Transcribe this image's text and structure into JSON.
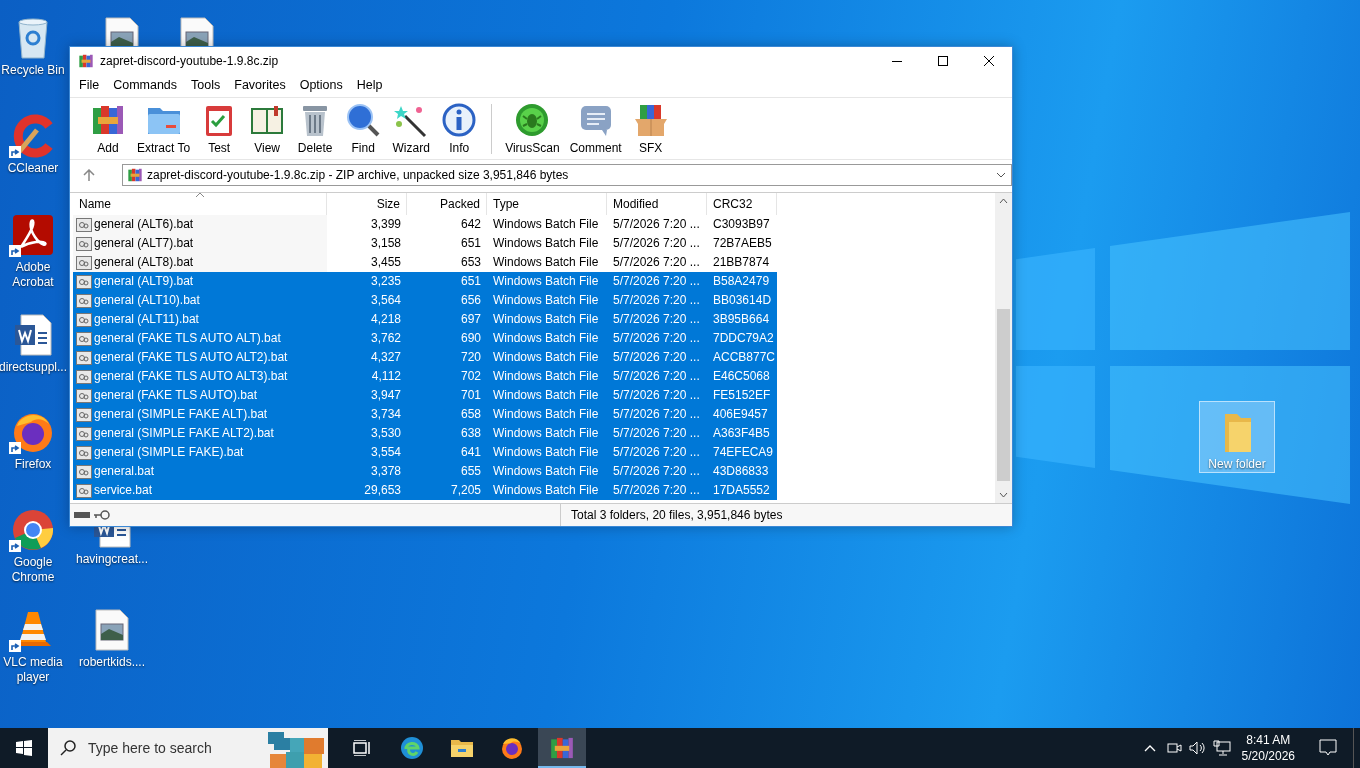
{
  "desktop": {
    "icons": [
      {
        "label": "Recycle Bin",
        "shortcut": false,
        "selected": false
      },
      {
        "label": "CCleaner",
        "shortcut": true,
        "selected": false
      },
      {
        "label": "Adobe Acrobat",
        "shortcut": true,
        "selected": false
      },
      {
        "label": "directsuppl...",
        "shortcut": false,
        "selected": false
      },
      {
        "label": "Firefox",
        "shortcut": true,
        "selected": false
      },
      {
        "label": "Google Chrome",
        "shortcut": true,
        "selected": false
      },
      {
        "label": "VLC media player",
        "shortcut": true,
        "selected": false
      },
      {
        "label": "havingcreat...",
        "shortcut": false,
        "selected": false
      },
      {
        "label": "robertkids....",
        "shortcut": false,
        "selected": false
      },
      {
        "label": "New folder",
        "shortcut": false,
        "selected": true
      }
    ]
  },
  "window": {
    "title": "zapret-discord-youtube-1.9.8c.zip",
    "menu": [
      "File",
      "Commands",
      "Tools",
      "Favorites",
      "Options",
      "Help"
    ],
    "toolbar": [
      [
        {
          "label": "Add"
        },
        {
          "label": "Extract To"
        },
        {
          "label": "Test"
        },
        {
          "label": "View"
        },
        {
          "label": "Delete"
        },
        {
          "label": "Find"
        },
        {
          "label": "Wizard"
        },
        {
          "label": "Info"
        }
      ],
      [
        {
          "label": "VirusScan"
        },
        {
          "label": "Comment"
        },
        {
          "label": "SFX"
        }
      ]
    ],
    "address": "zapret-discord-youtube-1.9.8c.zip - ZIP archive, unpacked size 3,951,846 bytes",
    "table": {
      "columns": [
        {
          "label": "Name",
          "sorted": true
        },
        {
          "label": "Size",
          "sorted": false
        },
        {
          "label": "Packed",
          "sorted": false
        },
        {
          "label": "Type",
          "sorted": false
        },
        {
          "label": "Modified",
          "sorted": false
        },
        {
          "label": "CRC32",
          "sorted": false
        }
      ],
      "rows": [
        {
          "cells": [
            "general (ALT6).bat",
            "3,399",
            "642",
            "Windows Batch File",
            "5/7/2026 7:20 ...",
            "C3093B97"
          ],
          "selected": false
        },
        {
          "cells": [
            "general (ALT7).bat",
            "3,158",
            "651",
            "Windows Batch File",
            "5/7/2026 7:20 ...",
            "72B7AEB5"
          ],
          "selected": false
        },
        {
          "cells": [
            "general (ALT8).bat",
            "3,455",
            "653",
            "Windows Batch File",
            "5/7/2026 7:20 ...",
            "21BB7874"
          ],
          "selected": false
        },
        {
          "cells": [
            "general (ALT9).bat",
            "3,235",
            "651",
            "Windows Batch File",
            "5/7/2026 7:20 ...",
            "B58A2479"
          ],
          "selected": true
        },
        {
          "cells": [
            "general (ALT10).bat",
            "3,564",
            "656",
            "Windows Batch File",
            "5/7/2026 7:20 ...",
            "BB03614D"
          ],
          "selected": true
        },
        {
          "cells": [
            "general (ALT11).bat",
            "4,218",
            "697",
            "Windows Batch File",
            "5/7/2026 7:20 ...",
            "3B95B664"
          ],
          "selected": true
        },
        {
          "cells": [
            "general (FAKE TLS AUTO ALT).bat",
            "3,762",
            "690",
            "Windows Batch File",
            "5/7/2026 7:20 ...",
            "7DDC79A2"
          ],
          "selected": true
        },
        {
          "cells": [
            "general (FAKE TLS AUTO ALT2).bat",
            "4,327",
            "720",
            "Windows Batch File",
            "5/7/2026 7:20 ...",
            "ACCB877C"
          ],
          "selected": true
        },
        {
          "cells": [
            "general (FAKE TLS AUTO ALT3).bat",
            "4,112",
            "702",
            "Windows Batch File",
            "5/7/2026 7:20 ...",
            "E46C5068"
          ],
          "selected": true
        },
        {
          "cells": [
            "general (FAKE TLS AUTO).bat",
            "3,947",
            "701",
            "Windows Batch File",
            "5/7/2026 7:20 ...",
            "FE5152EF"
          ],
          "selected": true
        },
        {
          "cells": [
            "general (SIMPLE FAKE ALT).bat",
            "3,734",
            "658",
            "Windows Batch File",
            "5/7/2026 7:20 ...",
            "406E9457"
          ],
          "selected": true
        },
        {
          "cells": [
            "general (SIMPLE FAKE ALT2).bat",
            "3,530",
            "638",
            "Windows Batch File",
            "5/7/2026 7:20 ...",
            "A363F4B5"
          ],
          "selected": true
        },
        {
          "cells": [
            "general (SIMPLE FAKE).bat",
            "3,554",
            "641",
            "Windows Batch File",
            "5/7/2026 7:20 ...",
            "74EFECA9"
          ],
          "selected": true
        },
        {
          "cells": [
            "general.bat",
            "3,378",
            "655",
            "Windows Batch File",
            "5/7/2026 7:20 ...",
            "43D86833"
          ],
          "selected": true
        },
        {
          "cells": [
            "service.bat",
            "29,653",
            "7,205",
            "Windows Batch File",
            "5/7/2026 7:20 ...",
            "17DA5552"
          ],
          "selected": true
        }
      ]
    },
    "status": "Total 3 folders, 20 files, 3,951,846 bytes"
  },
  "taskbar": {
    "search": {
      "placeholder": "Type here to search"
    },
    "apps": [
      {
        "active": false
      },
      {
        "active": false
      },
      {
        "active": false
      },
      {
        "active": true
      }
    ],
    "clock": {
      "time": "8:41 AM",
      "date": "5/20/2026"
    }
  }
}
